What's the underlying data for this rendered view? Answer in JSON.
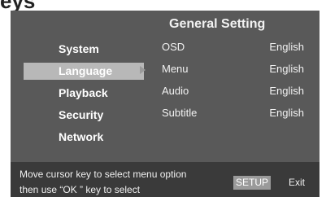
{
  "colors": {
    "panel_bg": "#595959",
    "footer_bg": "#3a3a3a",
    "selected_bg": "#b8b8b8",
    "text": "#f2f2f2"
  },
  "top_fragment": "eys",
  "title": "General Setting",
  "menu": {
    "items": [
      {
        "label": "System"
      },
      {
        "label": "Language"
      },
      {
        "label": "Playback"
      },
      {
        "label": "Security"
      },
      {
        "label": "Network"
      }
    ],
    "selected_index": 1
  },
  "settings": {
    "rows": [
      {
        "label": "OSD",
        "value": "English"
      },
      {
        "label": "Menu",
        "value": "English"
      },
      {
        "label": "Audio",
        "value": "English"
      },
      {
        "label": "Subtitle",
        "value": "English"
      }
    ]
  },
  "footer": {
    "line1": "Move cursor key to select menu option",
    "line2": "then use “OK ” key to select",
    "setup_key": "SETUP",
    "exit_label": "Exit"
  },
  "icons": {
    "selection_arrow": "triangle-right-icon"
  }
}
